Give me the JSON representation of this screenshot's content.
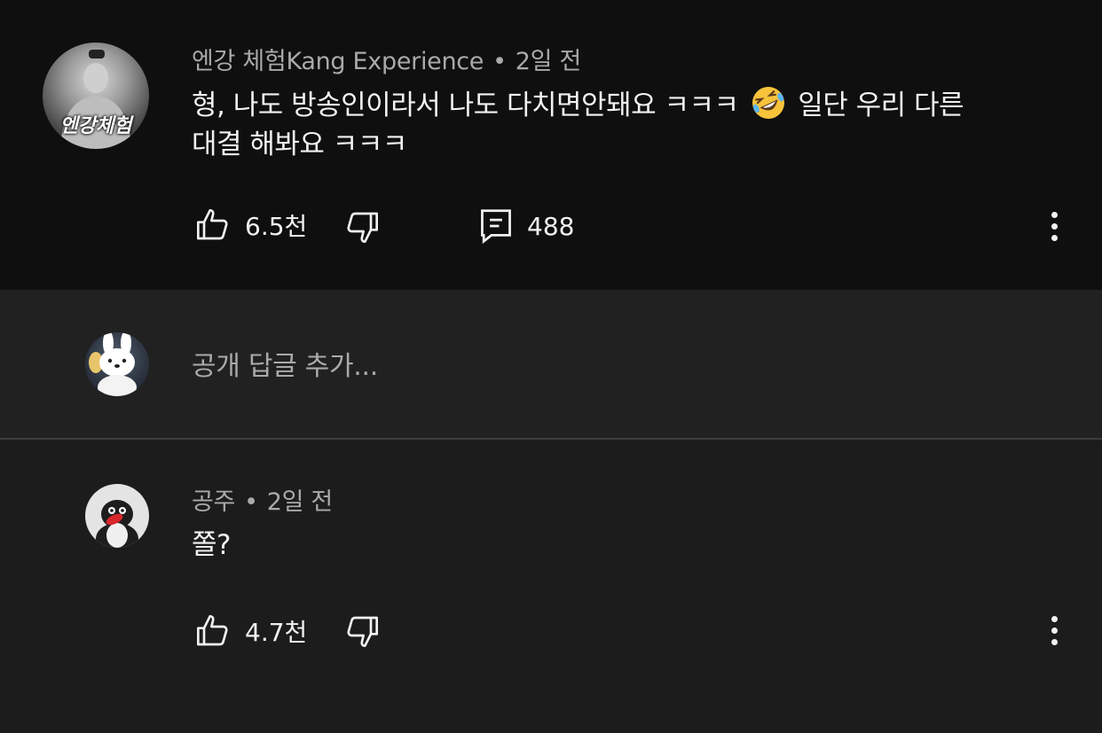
{
  "comment": {
    "author": "엔강 체험Kang Experience",
    "separator": "•",
    "time": "2일 전",
    "text_before_emoji": "형, 나도 방송인이라서 나도 다치면안돼요 ㅋㅋㅋ",
    "emoji": "🤣",
    "text_after_emoji": "일단 우리 다른",
    "text_line2": "대결 해봐요 ㅋㅋㅋ",
    "avatar_label": "엔강체험",
    "likes": "6.5천",
    "replies": "488",
    "icons": {
      "like": "thumbs-up-icon",
      "dislike": "thumbs-down-icon",
      "reply": "comment-icon",
      "more": "more-vertical-icon"
    }
  },
  "reply_input": {
    "placeholder": "공개 답글 추가..."
  },
  "reply": {
    "author": "공주",
    "separator": "•",
    "time": "2일 전",
    "text": "쫄?",
    "likes": "4.7천"
  },
  "colors": {
    "top_bg": "#0f0f0f",
    "reply_bar_bg": "#212121",
    "reply_bg": "#1c1c1c",
    "text_primary": "#f1f1f1",
    "text_secondary": "#aaaaaa"
  }
}
